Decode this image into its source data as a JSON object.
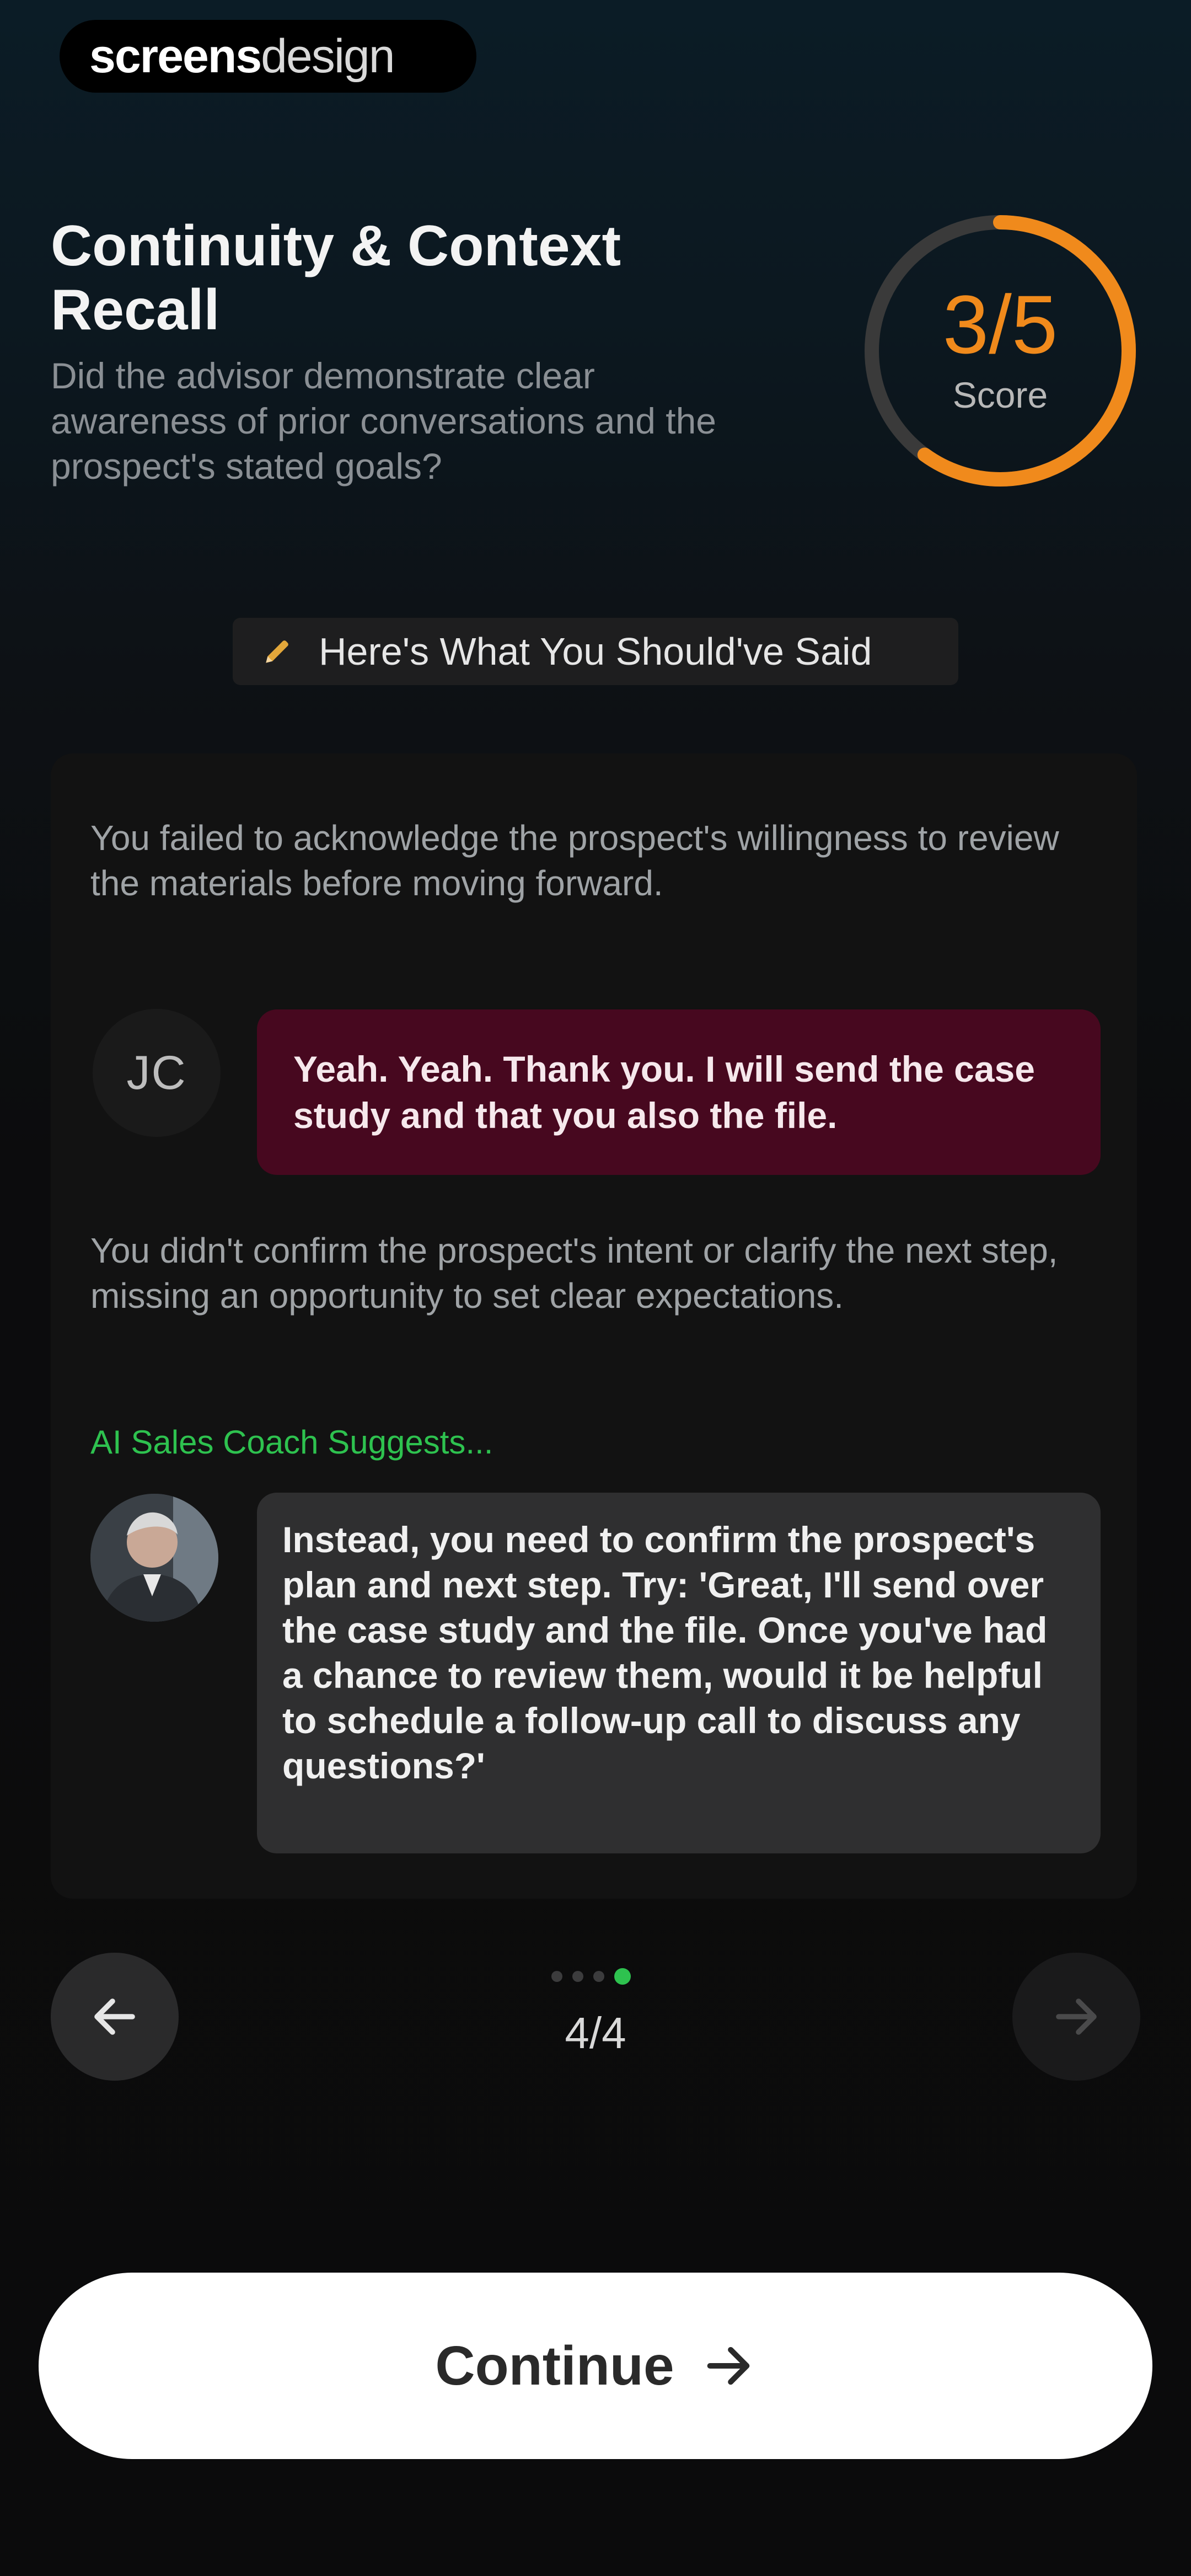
{
  "brand": {
    "part1": "screens",
    "part2": "design"
  },
  "header": {
    "title": "Continuity & Context Recall",
    "subtitle": "Did the advisor demonstrate clear awareness of prior conversations and the prospect's stated goals?"
  },
  "score": {
    "value": "3/5",
    "label": "Score",
    "fraction": 0.6,
    "accent_color": "#f08a1c"
  },
  "chip": {
    "icon": "pencil-icon",
    "label": "Here's What You Should've Said"
  },
  "card": {
    "feedback_1": "You failed to acknowledge the prospect's willingness to review the materials before moving forward.",
    "user_initials": "JC",
    "user_message": "Yeah. Yeah. Thank you. I will send the case study and that you also the file.",
    "feedback_2": "You didn't confirm the prospect's intent or clarify the next step, missing an opportunity to set clear expectations.",
    "coach_label": "AI Sales Coach Suggests...",
    "coach_message": "Instead, you need to confirm the prospect's plan and next step. Try: 'Great, I'll send over the case study and the file. Once you've had a chance to review them, would it be helpful to schedule a follow-up call to discuss any questions?'"
  },
  "pager": {
    "text": "4/4",
    "total": 4,
    "current": 4,
    "accent_color": "#2ec24f"
  },
  "footer": {
    "continue_label": "Continue"
  }
}
